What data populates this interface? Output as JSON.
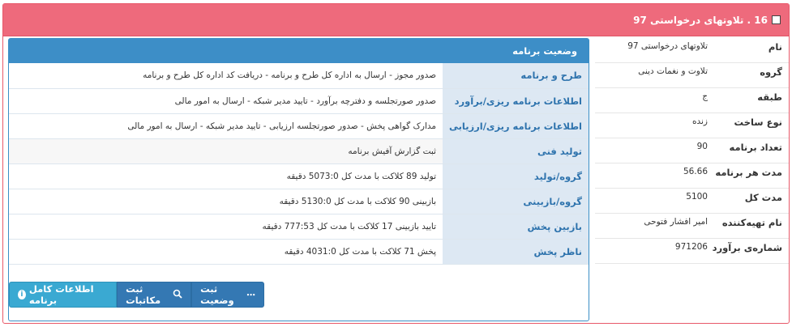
{
  "header": {
    "title": "16 . تلاوتهای درخواستی 97"
  },
  "info": [
    {
      "label": "نام",
      "value": "تلاوتهای درخواستی 97"
    },
    {
      "label": "گروه",
      "value": "تلاوت و نغمات دینی"
    },
    {
      "label": "طبقه",
      "value": "ج"
    },
    {
      "label": "نوع ساخت",
      "value": "زنده"
    },
    {
      "label": "تعداد برنامه",
      "value": "90"
    },
    {
      "label": "مدت هر برنامه",
      "value": "56.66"
    },
    {
      "label": "مدت کل",
      "value": "5100"
    },
    {
      "label": "نام تهیه‌کننده",
      "value": "امیر افشار فتوحی"
    },
    {
      "label": "شماره‌ی برآورد",
      "value": "971206"
    }
  ],
  "status": {
    "title": "وضعیت برنامه",
    "rows": [
      {
        "key": "طرح و برنامه",
        "value": "صدور مجوز - ارسال به اداره کل طرح و برنامه - دریافت کد اداره کل طرح و برنامه"
      },
      {
        "key": "اطلاعات برنامه ریزی/برآورد",
        "value": "صدور صورتجلسه و دفترچه برآورد - تایید مدیر شبکه - ارسال به امور مالی"
      },
      {
        "key": "اطلاعات برنامه ریزی/ارزیابی",
        "value": "مدارک گواهی پخش - صدور صورتجلسه ارزیابی - تایید مدیر شبکه - ارسال به امور مالی"
      },
      {
        "key": "تولید فنی",
        "value": "ثبت گزارش آفیش برنامه"
      },
      {
        "key": "گروه/تولید",
        "value": "تولید 89 کلاکت با مدت کل 5073:0 دقیقه"
      },
      {
        "key": "گروه/بازبینی",
        "value": "بازبینی 90 کلاکت با مدت کل 5130:0 دقیقه"
      },
      {
        "key": "بازبین پخش",
        "value": "تایید بازبینی 17 کلاکت با مدت کل 777:53 دقیقه"
      },
      {
        "key": "ناظر پخش",
        "value": "پخش 71 کلاکت با مدت کل 4031:0 دقیقه"
      }
    ]
  },
  "buttons": {
    "full_info": "اطلاعات کامل برنامه",
    "correspondence": "ثبت مکاتبات",
    "status": "ثبت وضعیت"
  }
}
